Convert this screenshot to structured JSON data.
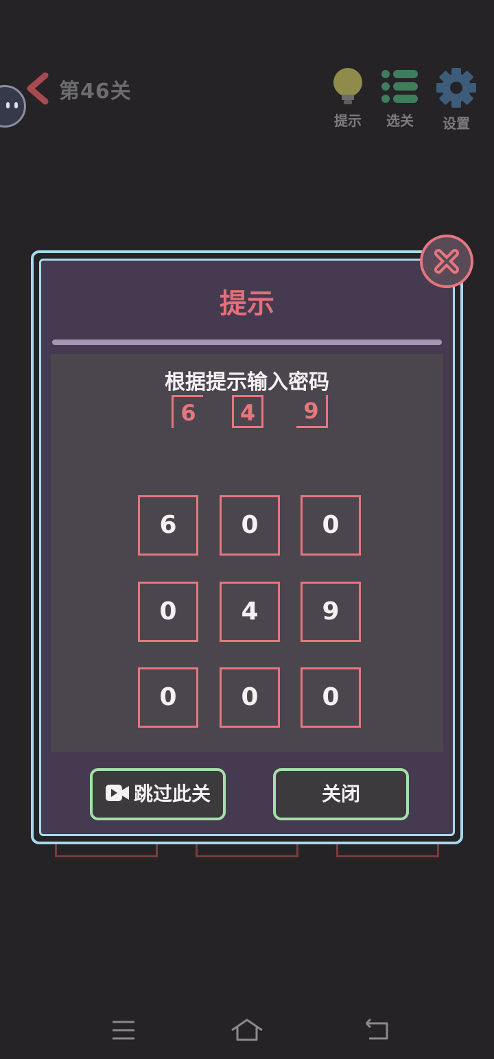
{
  "header": {
    "level_title": "第46关",
    "buttons": [
      {
        "label": "提示",
        "icon": "lightbulb-icon"
      },
      {
        "label": "选关",
        "icon": "list-icon"
      },
      {
        "label": "设置",
        "icon": "gear-icon"
      }
    ]
  },
  "dialog": {
    "title": "提示",
    "instruction": "根据提示输入密码",
    "hint_code": [
      "6",
      "4",
      "9"
    ],
    "keypad": [
      "6",
      "0",
      "0",
      "0",
      "4",
      "9",
      "0",
      "0",
      "0"
    ],
    "skip_label": "跳过此关",
    "close_label": "关闭"
  },
  "colors": {
    "background": "#252326",
    "dialog_bg": "#453a4f",
    "accent_red": "#e6767f",
    "border_blue": "#a9d8ec",
    "button_green": "#a4e0a9"
  }
}
